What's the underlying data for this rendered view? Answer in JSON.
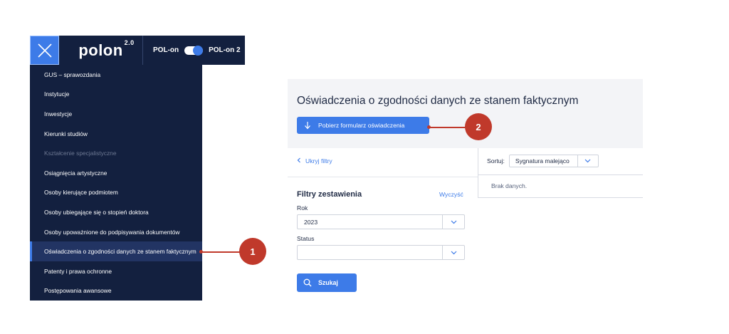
{
  "topbar": {
    "logo_text": "polon",
    "logo_version": "2.0",
    "switch_left_label": "POL-on",
    "switch_right_label": "POL-on 2",
    "switch_on": true
  },
  "menu": {
    "items": [
      {
        "label": "GUS – sprawozdania"
      },
      {
        "label": "Instytucje"
      },
      {
        "label": "Inwestycje"
      },
      {
        "label": "Kierunki studiów"
      },
      {
        "label": "Kształcenie specjalistyczne",
        "disabled": true
      },
      {
        "label": "Osiągnięcia artystyczne"
      },
      {
        "label": "Osoby kierujące podmiotem"
      },
      {
        "label": "Osoby ubiegające się o stopień doktora"
      },
      {
        "label": "Osoby upoważnione do podpisywania dokumentów"
      },
      {
        "label": "Oświadczenia o zgodności danych ze stanem faktycznym",
        "active": true
      },
      {
        "label": "Patenty i prawa ochronne"
      },
      {
        "label": "Postępowania awansowe"
      }
    ]
  },
  "callouts": {
    "first": "1",
    "second": "2"
  },
  "main": {
    "title": "Oświadczenia o zgodności danych ze stanem faktycznym",
    "download_button": "Pobierz formularz oświadczenia",
    "hide_filters": "Ukryj filtry",
    "sort_label": "Sortuj:",
    "sort_value": "Sygnatura malejąco",
    "results_text": "Brak danych.",
    "filters_title": "Filtry zestawienia",
    "clear_link": "Wyczyść",
    "year_label": "Rok",
    "year_value": "2023",
    "status_label": "Status",
    "status_value": "",
    "search_button": "Szukaj"
  },
  "colors": {
    "navy": "#13203f",
    "accent": "#3d7be8",
    "callout": "#c0392b"
  }
}
